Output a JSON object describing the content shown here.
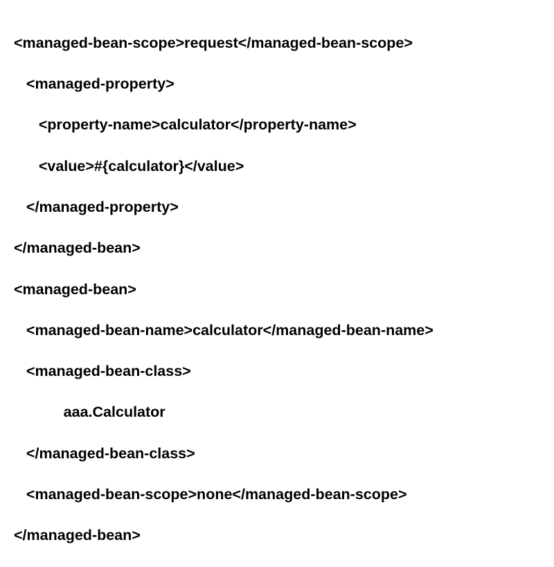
{
  "lines": {
    "l1": "<managed-bean-scope>request</managed-bean-scope>",
    "l2": "   <managed-property>",
    "l3": "      <property-name>calculator</property-name>",
    "l4": "      <value>#{calculator}</value>",
    "l5": "   </managed-property>",
    "l6": "</managed-bean>",
    "l7": "<managed-bean>",
    "l8": "   <managed-bean-name>calculator</managed-bean-name>",
    "l9": "   <managed-bean-class>",
    "l10": "            aaa.Calculator",
    "l11": "   </managed-bean-class>",
    "l12": "   <managed-bean-scope>none</managed-bean-scope>",
    "l13": "</managed-bean>"
  }
}
